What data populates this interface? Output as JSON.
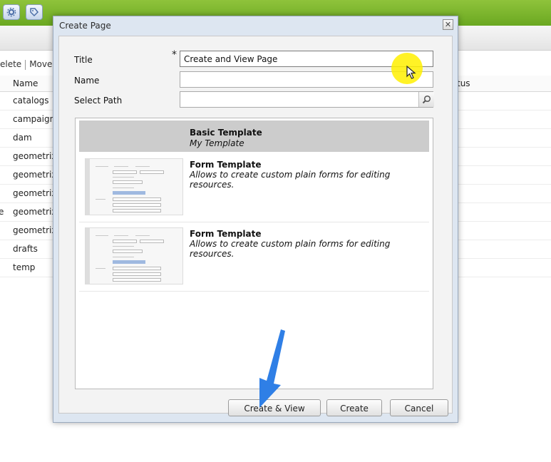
{
  "dialog": {
    "title": "Create Page",
    "close_label": "✕",
    "form": {
      "title_label": "Title",
      "title_required": "*",
      "title_value": "Create and View Page",
      "name_label": "Name",
      "name_value": "",
      "path_label": "Select Path",
      "path_value": ""
    },
    "templates": [
      {
        "title": "Basic Template",
        "description": "My Template",
        "selected": true
      },
      {
        "title": "Form Template",
        "description": "Allows to create custom plain forms for editing resources.",
        "selected": false
      },
      {
        "title": "Form Template",
        "description": "Allows to create custom plain forms for editing resources.",
        "selected": false
      }
    ],
    "buttons": {
      "create_view": "Create & View",
      "create": "Create",
      "cancel": "Cancel"
    }
  },
  "background": {
    "toolbar": {
      "delete": "elete",
      "move": "Move."
    },
    "columns": {
      "name": "Name",
      "status": "tus"
    },
    "rows": [
      "catalogs",
      "campaigns",
      "dam",
      "geometrix:",
      "geometrix:",
      "geometrix:",
      "geometrix:",
      "geometrix:",
      "drafts",
      "temp"
    ],
    "row_lead": "e"
  },
  "icons": {
    "toolbar_1": "settings-icon",
    "toolbar_2": "tag-icon",
    "search": "search-icon",
    "cursor": "mouse-pointer-icon",
    "arrow": "annotation-arrow-icon"
  },
  "colors": {
    "topbar": "#7bb52d",
    "selected_template": "#cccccc",
    "dialog_frame": "#dde6f1",
    "highlight": "#fff000",
    "arrow": "#2f7fe6"
  }
}
